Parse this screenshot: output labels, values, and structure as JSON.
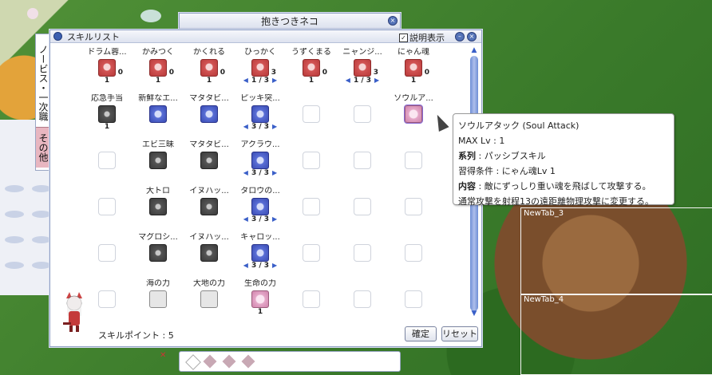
{
  "background_window": {
    "title": "抱きつきネコ"
  },
  "tabs": [
    {
      "label": "ノービス・一次職"
    },
    {
      "label": "その他"
    }
  ],
  "skill_window": {
    "title": "スキルリスト",
    "description_toggle": {
      "label": "説明表示",
      "checked": true
    },
    "skill_points_label": "スキルポイント : 5",
    "confirm_label": "確定",
    "reset_label": "リセット",
    "grid": [
      [
        {
          "name": "ドラム蓉...",
          "style": "red",
          "level": "1",
          "badge": "0"
        },
        {
          "name": "かみつく",
          "style": "red",
          "level": "1",
          "badge": "0"
        },
        {
          "name": "かくれる",
          "style": "red",
          "level": "1",
          "badge": "0"
        },
        {
          "name": "ひっかく",
          "style": "red",
          "stepper": "1 / 3",
          "badge": "3"
        },
        {
          "name": "うずくまる",
          "style": "red",
          "level": "1",
          "badge": "0"
        },
        {
          "name": "ニャンジ...",
          "style": "red",
          "stepper": "1 / 3",
          "badge": "3"
        },
        {
          "name": "にゃん魂",
          "style": "red",
          "level": "1",
          "badge": "0"
        }
      ],
      [
        {
          "name": "応急手当",
          "style": "dark",
          "level": "1"
        },
        {
          "name": "新鮮なエ...",
          "style": "blue",
          "level": ""
        },
        {
          "name": "マタタビ...",
          "style": "blue",
          "level": ""
        },
        {
          "name": "ピッキ突...",
          "style": "blue",
          "stepper": "3 / 3"
        },
        {
          "name": "",
          "style": "empty"
        },
        {
          "name": "",
          "style": "empty"
        },
        {
          "name": "ソウルア...",
          "style": "pink",
          "level": "",
          "selected": true
        }
      ],
      [
        {
          "name": "",
          "style": "empty"
        },
        {
          "name": "エビ三昧",
          "style": "dark",
          "level": ""
        },
        {
          "name": "マタタビ...",
          "style": "dark",
          "level": ""
        },
        {
          "name": "アクラウ...",
          "style": "blue",
          "stepper": "3 / 3"
        },
        {
          "name": "",
          "style": "empty"
        },
        {
          "name": "",
          "style": "empty"
        },
        {
          "name": "",
          "style": "empty"
        }
      ],
      [
        {
          "name": "",
          "style": "empty"
        },
        {
          "name": "大トロ",
          "style": "dark",
          "level": ""
        },
        {
          "name": "イヌハッ...",
          "style": "dark",
          "level": ""
        },
        {
          "name": "タロウの...",
          "style": "blue",
          "stepper": "3 / 3"
        },
        {
          "name": "",
          "style": "empty"
        },
        {
          "name": "",
          "style": "empty"
        },
        {
          "name": "",
          "style": "empty"
        }
      ],
      [
        {
          "name": "",
          "style": "empty"
        },
        {
          "name": "マグロシ...",
          "style": "dark",
          "level": ""
        },
        {
          "name": "イヌハッ...",
          "style": "dark",
          "level": ""
        },
        {
          "name": "キャロッ...",
          "style": "blue",
          "stepper": "3 / 3"
        },
        {
          "name": "",
          "style": "empty"
        },
        {
          "name": "",
          "style": "empty"
        },
        {
          "name": "",
          "style": "empty"
        }
      ],
      [
        {
          "name": "",
          "style": "empty"
        },
        {
          "name": "海の力",
          "style": "gray",
          "level": ""
        },
        {
          "name": "大地の力",
          "style": "gray",
          "level": ""
        },
        {
          "name": "生命の力",
          "style": "pink",
          "level": "1"
        },
        {
          "name": "",
          "style": "empty"
        },
        {
          "name": "",
          "style": "empty"
        },
        {
          "name": "",
          "style": "empty"
        }
      ]
    ]
  },
  "tooltip": {
    "title": "ソウルアタック (Soul Attack)",
    "max_lv": "MAX Lv : 1",
    "type_label": "系列",
    "type_value": " : パッシブスキル",
    "req": "習得条件 : にゃん魂Lv 1",
    "content_label": "内容",
    "content_value": " : 敵にずっしり重い魂を飛ばして攻撃する。",
    "note": "通常攻撃を射程13の遠距離物理攻撃に変更する。"
  },
  "side_tabs": {
    "tab3": "NewTab_3",
    "tab4": "NewTab_4"
  },
  "colors": {
    "accent": "#3a5fc8",
    "tab_pink": "#e8b6c0",
    "window_border": "#8fa0c4"
  }
}
